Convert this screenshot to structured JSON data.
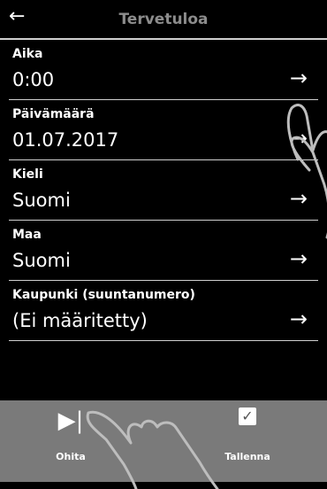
{
  "header": {
    "title": "Tervetuloa",
    "back_icon": "←"
  },
  "rows": [
    {
      "label": "Aika",
      "value": "0:00",
      "arrow": "→"
    },
    {
      "label": "Päivämäärä",
      "value": "01.07.2017",
      "arrow": "→"
    },
    {
      "label": "Kieli",
      "value": "Suomi",
      "arrow": "→"
    },
    {
      "label": "Maa",
      "value": "Suomi",
      "arrow": "→"
    },
    {
      "label": "Kaupunki (suuntanumero)",
      "value": "(Ei määritetty)",
      "arrow": "→"
    }
  ],
  "bottom_bar": {
    "skip": {
      "label": "Ohita",
      "icon": "▶|"
    },
    "save": {
      "label": "Tallenna",
      "icon": "✓"
    }
  },
  "colors": {
    "background": "#000000",
    "bottom_bar": "#7a7a7a",
    "title": "#8c8c8c"
  }
}
